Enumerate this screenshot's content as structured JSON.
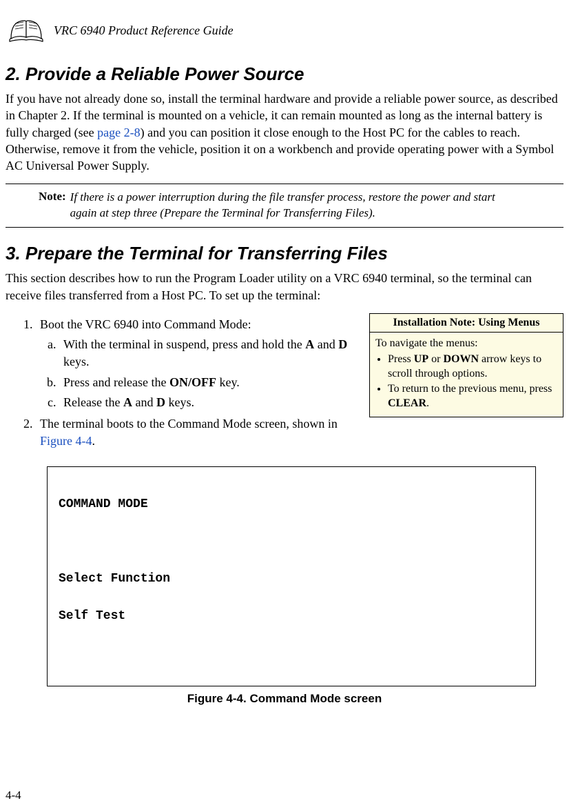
{
  "header": {
    "title": "VRC 6940 Product Reference Guide"
  },
  "section2": {
    "heading": "2. Provide a Reliable Power Source",
    "para_pre": "If you have not already done so, install the terminal hardware and provide a reliable power source, as described in Chapter 2. If the terminal is mounted on a vehicle, it can remain mounted as long as the internal battery is fully charged (see ",
    "link": "page 2-8",
    "para_post": ") and you can position it close enough to the Host PC for the cables to reach. Otherwise, remove it from the vehicle, position it on a workbench and provide operating power with a Symbol AC Universal Power Supply."
  },
  "note": {
    "label": "Note:",
    "text": "If there is a power interruption during the file transfer process, restore the power and start again at step three (Prepare the Terminal for Transferring Files)."
  },
  "section3": {
    "heading": "3. Prepare the Terminal for Transferring Files",
    "intro": "This section describes how to run the Program Loader utility on a VRC 6940 terminal, so the terminal can receive files transferred from a Host PC. To set up the terminal:",
    "step1": "Boot the VRC 6940 into Command Mode:",
    "step1a_pre": "With the terminal in suspend, press and hold the ",
    "step1a_kA": "A",
    "step1a_mid": " and ",
    "step1a_kD": "D",
    "step1a_post": " keys.",
    "step1b_pre": "Press and release the ",
    "step1b_k": "ON/OFF",
    "step1b_post": " key.",
    "step1c_pre": "Release the ",
    "step1c_kA": "A",
    "step1c_mid": " and ",
    "step1c_kD": "D",
    "step1c_post": " keys.",
    "step2_pre": "The terminal boots to the Command Mode screen, shown in ",
    "step2_link": "Figure 4-4",
    "step2_post": "."
  },
  "sidebar": {
    "title": "Installation Note: Using Menus",
    "lead": "To navigate the menus:",
    "b1_pre": "Press ",
    "b1_k1": "UP",
    "b1_mid": " or ",
    "b1_k2": "DOWN",
    "b1_post": " arrow keys to scroll through options.",
    "b2_pre": "To return to the previous menu, press ",
    "b2_k": "CLEAR",
    "b2_post": "."
  },
  "screen": {
    "line1": "COMMAND MODE",
    "line2": "Select Function",
    "line3": "Self Test"
  },
  "figure_caption": "Figure 4-4.  Command Mode screen",
  "page_number": "4-4"
}
